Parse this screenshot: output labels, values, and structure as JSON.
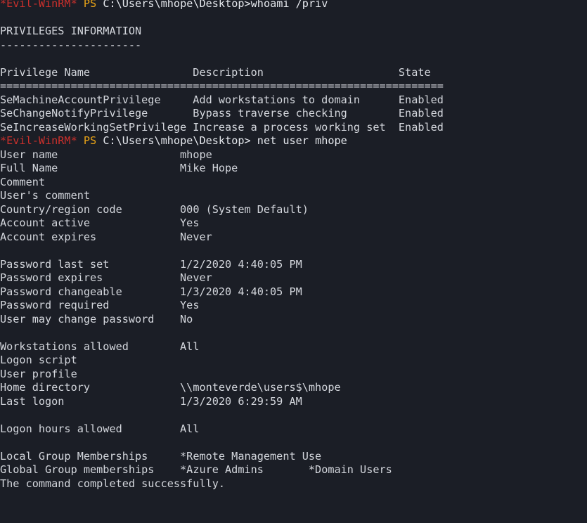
{
  "terminal": {
    "title": "Evil-WinRM PowerShell Session",
    "background_color": "#1b1e26",
    "foreground_color": "#d4d7dd",
    "prompt_marker_color": "#c9302c",
    "prompt_ps_color": "#e8a317",
    "columns": 68,
    "rows": 38
  },
  "prompts": {
    "marker": "*Evil-WinRM*",
    "ps": "PS",
    "path": "C:\\Users\\mhope\\Desktop>",
    "path_with_space": "C:\\Users\\mhope\\Desktop> ",
    "command_1": "whoami /priv",
    "command_2": "net user mhope"
  },
  "whoami_output": {
    "heading": "PRIVILEGES INFORMATION",
    "heading_underline": "----------------------",
    "headers": {
      "name": "Privilege Name",
      "description": "Description",
      "state": "State"
    },
    "separators": {
      "name": "==============================",
      "description": "================================",
      "state": "======="
    },
    "rows": [
      {
        "name": "SeMachineAccountPrivilege",
        "description": "Add workstations to domain",
        "state": "Enabled"
      },
      {
        "name": "SeChangeNotifyPrivilege",
        "description": "Bypass traverse checking",
        "state": "Enabled"
      },
      {
        "name": "SeIncreaseWorkingSetPrivilege",
        "description": "Increase a process working set",
        "state": "Enabled"
      }
    ]
  },
  "net_user_output": {
    "fields": [
      {
        "label": "User name",
        "value": "mhope"
      },
      {
        "label": "Full Name",
        "value": "Mike Hope"
      },
      {
        "label": "Comment",
        "value": ""
      },
      {
        "label": "User's comment",
        "value": ""
      },
      {
        "label": "Country/region code",
        "value": "000 (System Default)"
      },
      {
        "label": "Account active",
        "value": "Yes"
      },
      {
        "label": "Account expires",
        "value": "Never"
      },
      {
        "label": "Password last set",
        "value": "1/2/2020 4:40:05 PM"
      },
      {
        "label": "Password expires",
        "value": "Never"
      },
      {
        "label": "Password changeable",
        "value": "1/3/2020 4:40:05 PM"
      },
      {
        "label": "Password required",
        "value": "Yes"
      },
      {
        "label": "User may change password",
        "value": "No"
      },
      {
        "label": "Workstations allowed",
        "value": "All"
      },
      {
        "label": "Logon script",
        "value": ""
      },
      {
        "label": "User profile",
        "value": ""
      },
      {
        "label": "Home directory",
        "value": "\\\\monteverde\\users$\\mhope"
      },
      {
        "label": "Last logon",
        "value": "1/3/2020 6:29:59 AM"
      },
      {
        "label": "Logon hours allowed",
        "value": "All"
      }
    ],
    "local_group_label": "Local Group Memberships",
    "local_groups": [
      "*Remote Management Use"
    ],
    "global_group_label": "Global Group memberships",
    "global_groups": [
      "*Azure Admins",
      "*Domain Users"
    ],
    "status": "The command completed successfully."
  }
}
